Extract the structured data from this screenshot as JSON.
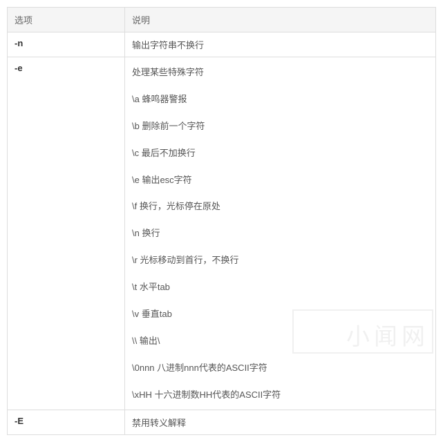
{
  "headers": {
    "option": "选项",
    "description": "说明"
  },
  "rows": [
    {
      "option": "-n",
      "lines": [
        "输出字符串不换行"
      ]
    },
    {
      "option": "-e",
      "lines": [
        "处理某些特殊字符",
        "\\a 蜂鸣器警报",
        "\\b 删除前一个字符",
        "\\c 最后不加换行",
        "\\e 输出esc字符",
        "\\f 换行，光标停在原处",
        "\\n 换行",
        "\\r 光标移动到首行，不换行",
        "\\t 水平tab",
        "\\v 垂直tab",
        "\\\\ 输出\\",
        "\\0nnn 八进制nnn代表的ASCII字符",
        "\\xHH 十六进制数HH代表的ASCII字符"
      ]
    },
    {
      "option": "-E",
      "lines": [
        "禁用转义解释"
      ]
    }
  ],
  "watermark": "小闻网"
}
